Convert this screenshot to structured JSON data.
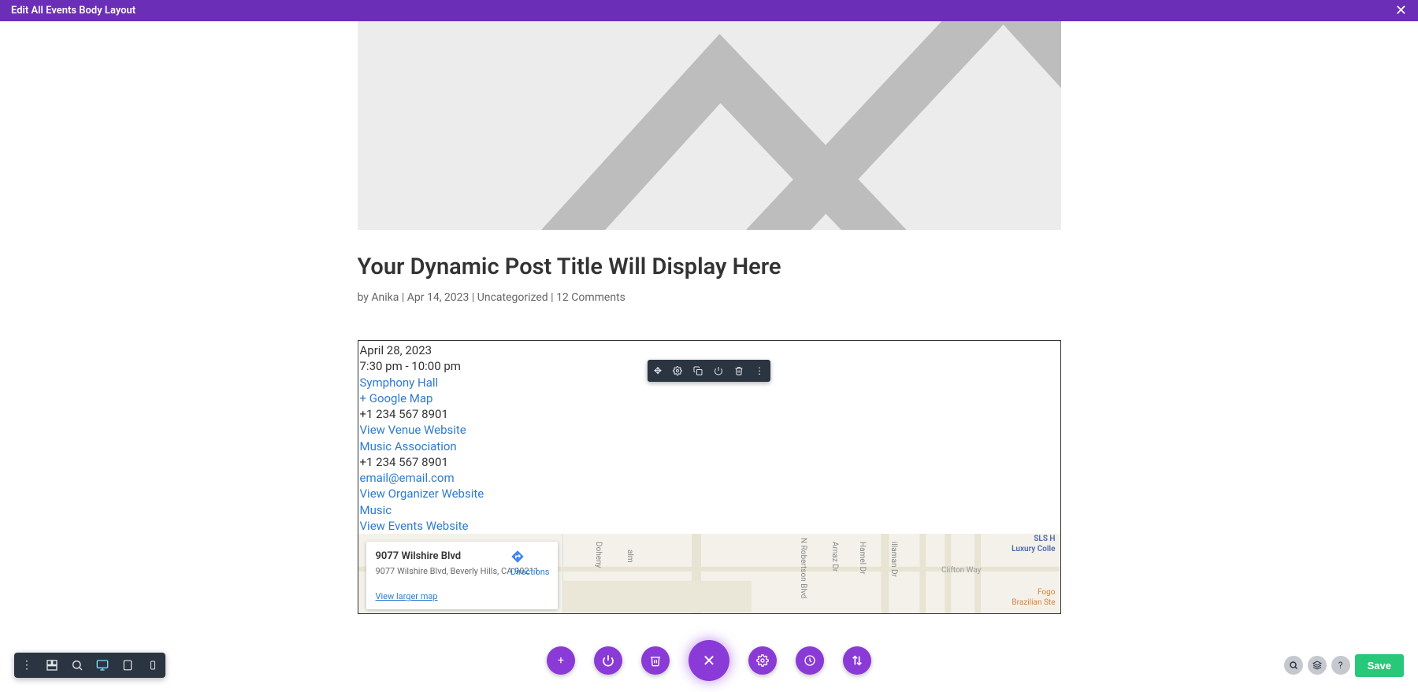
{
  "topBar": {
    "title": "Edit All Events Body Layout"
  },
  "post": {
    "title": "Your Dynamic Post Title Will Display Here",
    "metaBy": "by ",
    "metaAuthor": "Anika",
    "metaSep1": " | ",
    "metaDate": "Apr 14, 2023",
    "metaSep2": " | ",
    "metaCategory": "Uncategorized",
    "metaSep3": " | ",
    "metaComments": "12 Comments"
  },
  "event": {
    "date": "April 28, 2023",
    "time": "7:30 pm - 10:00 pm",
    "venue": "Symphony Hall",
    "googleMap": "+ Google Map",
    "phone1": "+1 234 567 8901",
    "venueWebsite": "View Venue Website",
    "organizer": "Music Association",
    "phone2": "+1 234 567 8901",
    "email": "email@email.com",
    "organizerWebsite": "View Organizer Website",
    "category": "Music",
    "eventsWebsite": "View Events Website"
  },
  "map": {
    "addressTitle": "9077 Wilshire Blvd",
    "addressLine": "9077 Wilshire Blvd, Beverly Hills, CA 90211",
    "largerMap": "View larger map",
    "directions": "Directions",
    "clifton": "Clifton Way",
    "poi1": "SLS H\nLuxury Colle",
    "poi2": "Fogo\nBrazilian Ste",
    "streets": [
      "Doheny",
      "alm",
      "N Robertson Blvd",
      "Arnaz Dr",
      "Hamel Dr",
      "illaman Dr"
    ]
  },
  "bottomBar": {
    "save": "Save"
  }
}
